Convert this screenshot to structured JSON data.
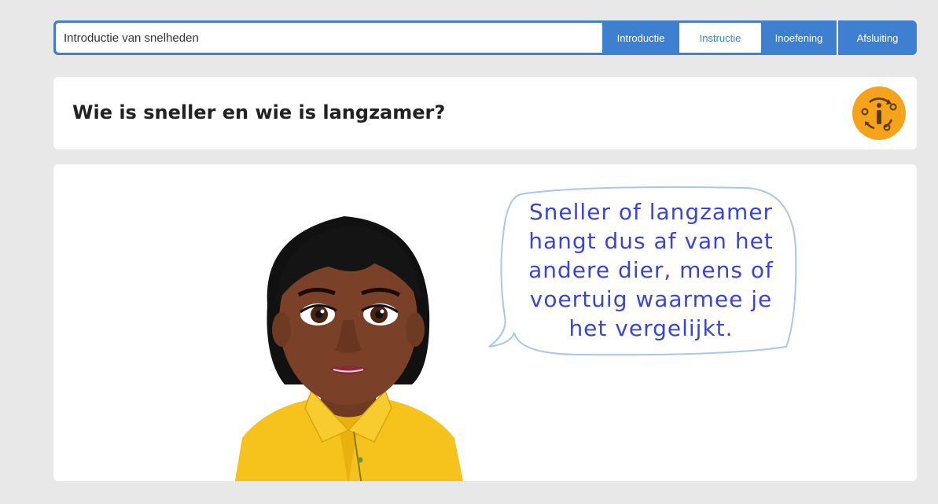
{
  "lesson": {
    "title": "Introductie van snelheden"
  },
  "tabs": [
    {
      "label": "Introductie",
      "active": false
    },
    {
      "label": "Instructie",
      "active": true
    },
    {
      "label": "Inoefening",
      "active": false
    },
    {
      "label": "Afsluiting",
      "active": false
    }
  ],
  "header": {
    "question": "Wie is sneller en wie is langzamer?",
    "info_icon": "info-cycle-icon"
  },
  "speech": {
    "lines": [
      "Sneller of langzamer",
      "hangt dus af van het",
      "andere dier, mens of",
      "voertuig waarmee je",
      "het vergelijkt."
    ]
  },
  "colors": {
    "accent": "#3f7fd0",
    "badge": "#f5a31a",
    "speech_text": "#3a45d8",
    "shirt": "#f6c21c"
  }
}
